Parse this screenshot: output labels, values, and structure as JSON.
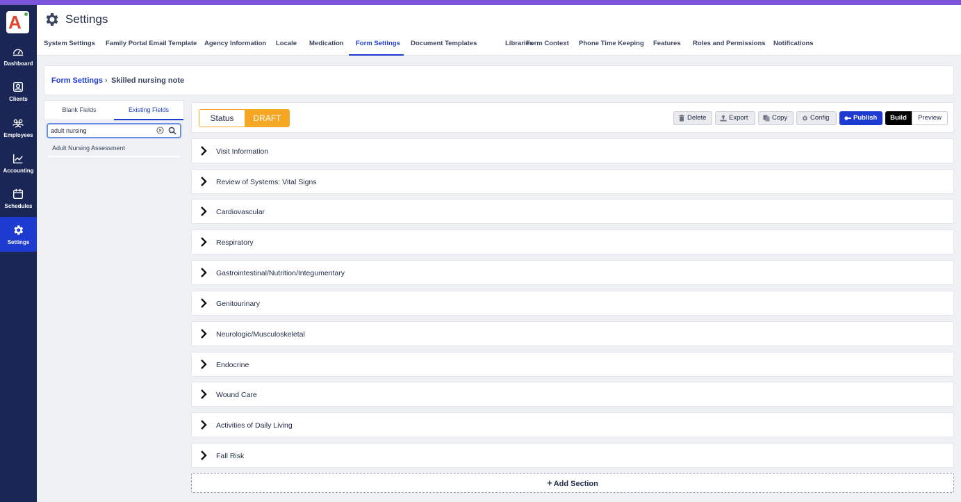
{
  "sidebar": {
    "items": [
      {
        "label": "Dashboard",
        "icon": "dashboard-icon"
      },
      {
        "label": "Clients",
        "icon": "clients-icon"
      },
      {
        "label": "Employees",
        "icon": "employees-icon"
      },
      {
        "label": "Accounting",
        "icon": "accounting-icon"
      },
      {
        "label": "Schedules",
        "icon": "calendar-icon"
      },
      {
        "label": "Settings",
        "icon": "gear-icon"
      }
    ],
    "active": "Settings"
  },
  "header": {
    "title": "Settings",
    "tabs": [
      "System Settings",
      "Family Portal Email Template",
      "Agency Information",
      "Locale",
      "Medication",
      "Form Settings",
      "Document Templates",
      "Libraries",
      "Form Context",
      "Phone Time Keeping",
      "Features",
      "Roles and Permissions",
      "Notifications"
    ],
    "active_tab": "Form Settings"
  },
  "breadcrumb": {
    "parent": "Form Settings",
    "separator": "›",
    "current": "Skilled nursing note"
  },
  "field_panel": {
    "tabs": [
      "Blank Fields",
      "Existing Fields"
    ],
    "active_tab": "Existing Fields",
    "search_value": "adult nursing",
    "results": [
      "Adult Nursing Assessment"
    ]
  },
  "toolbar": {
    "status_label": "Status",
    "status_value": "DRAFT",
    "buttons": [
      "Delete",
      "Export",
      "Copy",
      "Config",
      "Publish"
    ],
    "mode": [
      "Build",
      "Preview"
    ],
    "active_mode": "Build"
  },
  "sections": [
    "Visit Information",
    "Review of Systems: Vital Signs",
    "Cardiovascular",
    "Respiratory",
    "Gastrointestinal/Nutrition/Integumentary",
    "Genitourinary",
    "Neurologic/Musculoskeletal",
    "Endocrine",
    "Wound Care",
    "Activities of Daily Living",
    "Fall Risk"
  ],
  "add_section_label": "Add Section",
  "colors": {
    "sidebar_bg": "#1a2656",
    "accent": "#1e3bd1",
    "draft": "#f5a623",
    "top_bar": "#7b55d9"
  }
}
